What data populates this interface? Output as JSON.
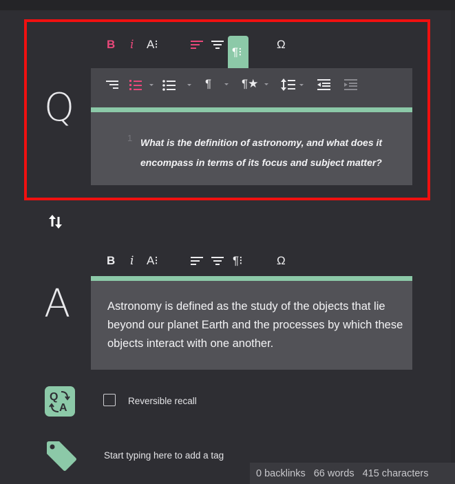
{
  "question": {
    "letter": "Q",
    "toolbar": {
      "bold": "B",
      "italic": "i",
      "font_size": "A⁝",
      "align_left": "≡",
      "align_center": "≡",
      "paragraph": "¶⁝",
      "special_char": "Ω"
    },
    "subtoolbar": {
      "align_right": "≡",
      "ordered_list": "list",
      "bullet_list": "list",
      "paragraph_format": "¶",
      "paragraph_style": "¶★",
      "line_height": "↕",
      "outdent": "outdent",
      "indent": "indent"
    },
    "line_number": "1",
    "text": "What is the definition of astronomy, and what does it encompass in terms of its focus and subject matter?"
  },
  "answer": {
    "letter": "A",
    "toolbar": {
      "bold": "B",
      "italic": "i",
      "font_size": "A⁝",
      "align_left": "≡",
      "align_center": "≡",
      "paragraph": "¶⁝",
      "special_char": "Ω"
    },
    "text": "Astronomy is defined as the study of the objects that lie beyond our planet Earth and the processes by which these objects interact with one another."
  },
  "reversible": {
    "label": "Reversible recall",
    "checked": false
  },
  "tags": {
    "placeholder": "Start typing here to add a tag"
  },
  "status": {
    "backlinks": "0 backlinks",
    "words": "66 words",
    "characters": "415 characters"
  },
  "icons": {
    "swap": "swap-vertical-icon",
    "qa": "qa-badge-icon",
    "tag": "tag-icon"
  },
  "colors": {
    "accent": "#8cc9a8",
    "pink": "#e9487a",
    "highlight": "#f01010",
    "background": "#2e2e33",
    "editor": "#525257"
  }
}
